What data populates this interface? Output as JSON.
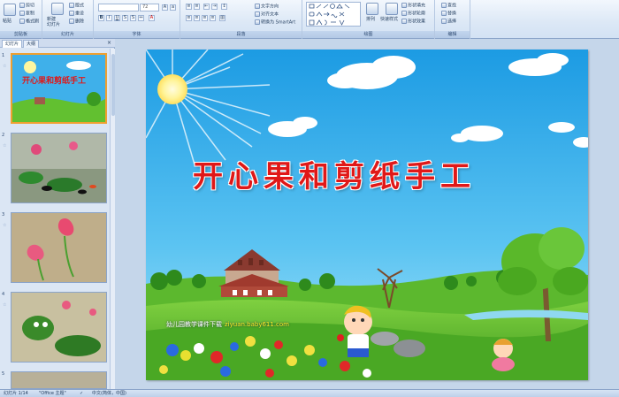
{
  "ribbon": {
    "clipboard": {
      "label": "剪贴板",
      "paste": "粘贴",
      "cut": "剪切",
      "copy": "复制",
      "format_painter": "格式刷"
    },
    "slides": {
      "label": "幻灯片",
      "new_slide": "新建\n幻灯片",
      "layout": "版式",
      "reset": "重设",
      "delete": "删除"
    },
    "font": {
      "label": "字体",
      "size": "72"
    },
    "paragraph": {
      "label": "段落",
      "text_direction": "文字方向",
      "align_text": "对齐文本",
      "smartart": "转换为 SmartArt"
    },
    "drawing": {
      "label": "绘图",
      "arrange": "排列",
      "quick_styles": "快速样式",
      "shape_fill": "形状填充",
      "shape_outline": "形状轮廓",
      "shape_effects": "形状效果"
    },
    "editing": {
      "label": "编辑",
      "find": "查找",
      "replace": "替换",
      "select": "选择"
    }
  },
  "pane": {
    "tab_slides": "幻灯片",
    "tab_outline": "大纲",
    "close": "×",
    "thumbnails": [
      {
        "number": "1",
        "star": "☆"
      },
      {
        "number": "2",
        "star": "☆"
      },
      {
        "number": "3",
        "star": "☆"
      },
      {
        "number": "4",
        "star": "☆"
      },
      {
        "number": "5",
        "star": "☆"
      }
    ]
  },
  "slide": {
    "title": "开心果和剪纸手工",
    "watermark_text": "幼儿园教学课件下载",
    "watermark_url": "ziyuan.baby611.com"
  },
  "status": {
    "slide_count": "幻灯片 1/14",
    "theme": "\"Office 主题\"",
    "language": "中文(简体，中国)"
  },
  "colors": {
    "sky": "#32aaea",
    "grass": "#5cb82e",
    "title_red": "#e01818",
    "ribbon": "#dce8f6"
  }
}
